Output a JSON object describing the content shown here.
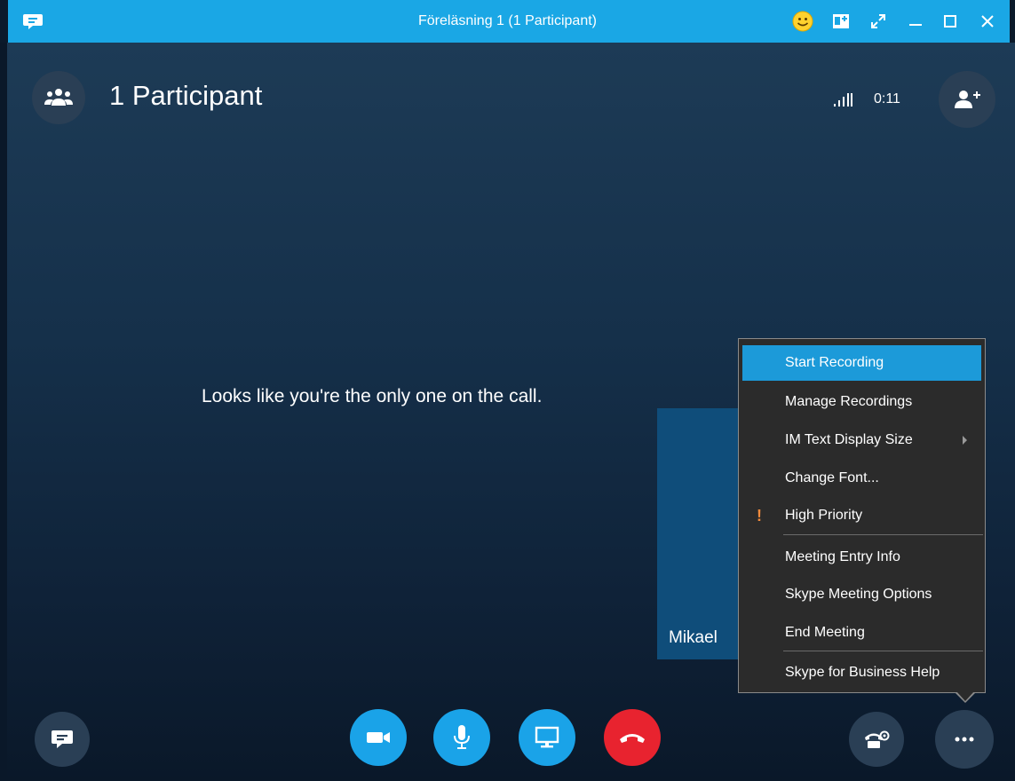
{
  "window": {
    "title": "Föreläsning 1 (1 Participant)"
  },
  "header": {
    "participants_label": "1 Participant",
    "timer": "0:11",
    "signal": ".ıll"
  },
  "stage": {
    "message": "Looks like you're the only one on the call.",
    "self_name": "Mikael"
  },
  "menu": {
    "items": [
      {
        "label": "Start Recording",
        "highlighted": true
      },
      {
        "label": "Manage Recordings"
      },
      {
        "label": "IM Text Display Size",
        "has_submenu": true
      },
      {
        "label": "Change Font..."
      },
      {
        "label": "High Priority",
        "mark": "!"
      },
      {
        "label": "Meeting Entry Info"
      },
      {
        "label": "Skype Meeting Options"
      },
      {
        "label": "End Meeting"
      },
      {
        "label": "Skype for Business Help"
      }
    ]
  },
  "colors": {
    "accent": "#1aa7e5",
    "hangup": "#e8232f",
    "menu_highlight": "#1c9ad9",
    "priority": "#f08a3c"
  },
  "icons": {
    "titlebar": [
      "chat-icon",
      "emoji-icon",
      "contact-card-icon",
      "fullscreen-icon",
      "minimize-icon",
      "maximize-icon",
      "close-icon"
    ],
    "header": [
      "participants-icon",
      "signal-icon",
      "add-person-icon"
    ],
    "bottom": [
      "chat-icon",
      "video-icon",
      "microphone-icon",
      "screen-share-icon",
      "hang-up-icon",
      "call-controls-icon",
      "more-options-icon"
    ]
  }
}
